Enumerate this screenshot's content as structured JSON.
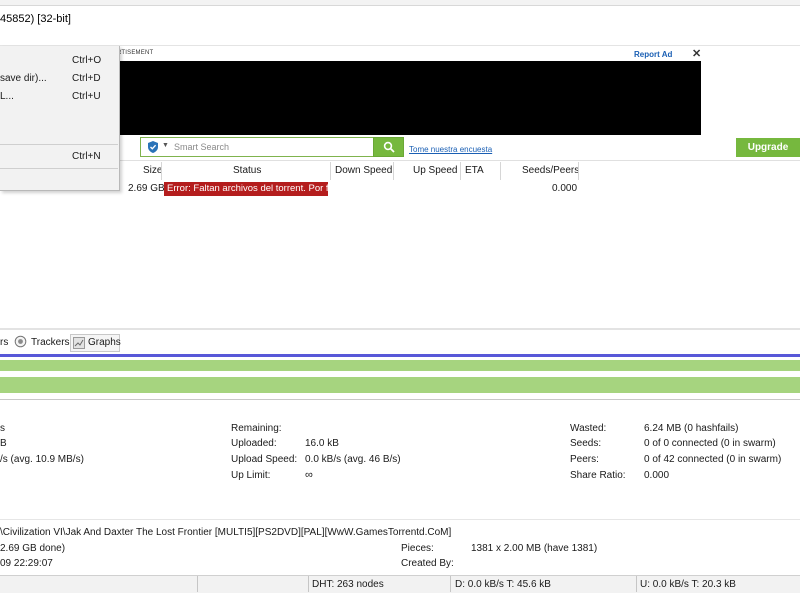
{
  "window": {
    "title": "45852) [32-bit]"
  },
  "advertisement": {
    "label": "RTISEMENT",
    "report_ad": "Report Ad",
    "close": "✕"
  },
  "menu": {
    "items": [
      {
        "label": "",
        "shortcut": "Ctrl+O"
      },
      {
        "label": "save dir)...",
        "shortcut": "Ctrl+D"
      },
      {
        "label": "L...",
        "shortcut": "Ctrl+U"
      },
      {
        "label": "",
        "shortcut": "Ctrl+N"
      }
    ]
  },
  "toolbar": {
    "search_placeholder": "Smart Search",
    "survey_link": "Tome nuestra encuesta",
    "upgrade": "Upgrade"
  },
  "table": {
    "columns": [
      "Size",
      "Status",
      "Down Speed",
      "Up Speed",
      "ETA",
      "Seeds/Peers"
    ],
    "row": {
      "size": "2.69 GB",
      "status": "Error: Faltan archivos del torrent. Por f",
      "seeds_peers": "0.000"
    }
  },
  "detail_tabs": {
    "partial": "rs",
    "trackers": "Trackers",
    "graphs": "Graphs"
  },
  "transfer": {
    "col1": [
      "s",
      "B",
      "/s (avg. 10.9 MB/s)"
    ],
    "remaining_label": "Remaining:",
    "uploaded_label": "Uploaded:",
    "uploaded_value": "16.0 kB",
    "upload_speed_label": "Upload Speed:",
    "upload_speed_value": "0.0 kB/s (avg. 46 B/s)",
    "up_limit_label": "Up Limit:",
    "up_limit_value": "∞",
    "wasted_label": "Wasted:",
    "wasted_value": "6.24 MB (0 hashfails)",
    "seeds_label": "Seeds:",
    "seeds_value": "0 of 0 connected (0 in swarm)",
    "peers_label": "Peers:",
    "peers_value": "0 of 42 connected (0 in swarm)",
    "share_ratio_label": "Share Ratio:",
    "share_ratio_value": "0.000"
  },
  "general": {
    "path": "\\Civilization VI\\Jak And Daxter The Lost Frontier [MULTI5][PS2DVD][PAL][WwW.GamesTorrentd.CoM]",
    "size_done": "2.69 GB done)",
    "date": "09 22:29:07",
    "pieces_label": "Pieces:",
    "pieces_value": "1381 x 2.00 MB (have 1381)",
    "created_by_label": "Created By:"
  },
  "statusbar": {
    "dht": "DHT: 263 nodes",
    "down": "D: 0.0 kB/s T: 45.6 kB",
    "up": "U: 0.0 kB/s T: 20.3 kB"
  },
  "colors": {
    "accent_green": "#76b83e",
    "error_red": "#b41d1d",
    "progress_green": "#a6d47f",
    "link_blue": "#1a5fb4"
  },
  "icons": {
    "search": "search-icon",
    "shield": "shield-icon",
    "trackers": "trackers-icon",
    "graphs": "graphs-icon"
  }
}
